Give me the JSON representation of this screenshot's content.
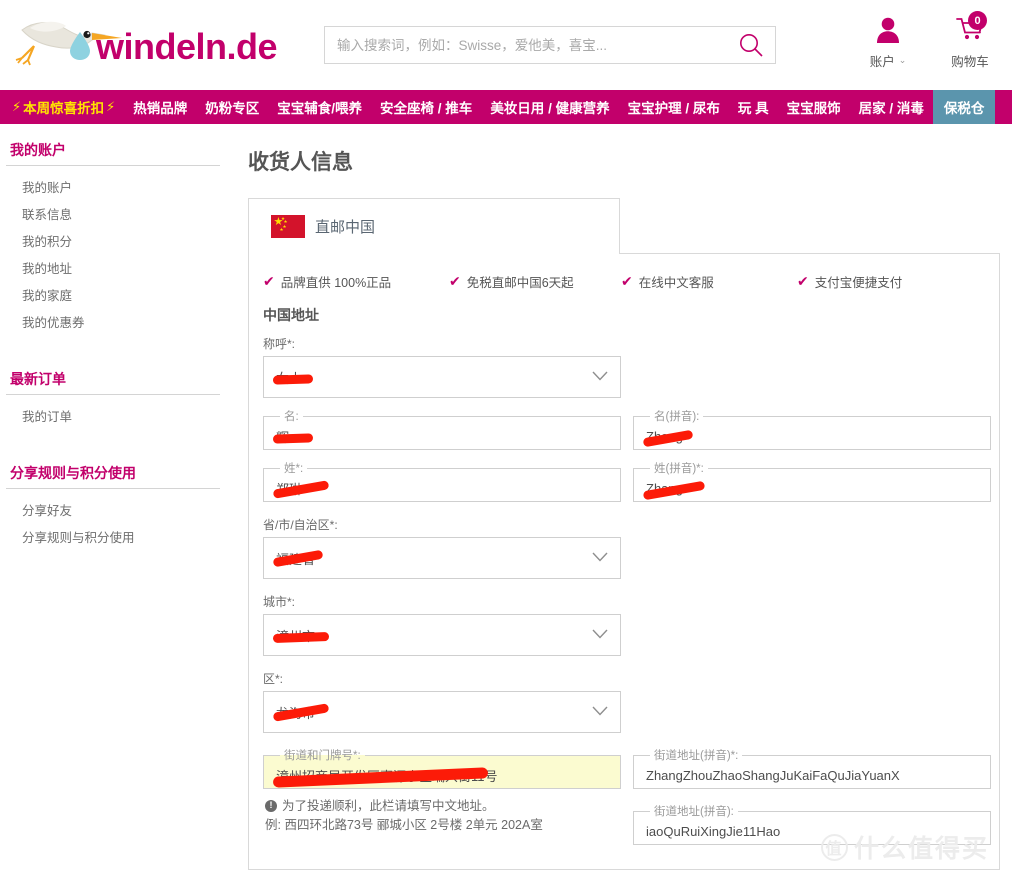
{
  "brand": {
    "name": "windeln.de",
    "logo_icon": "stork-logo",
    "accent": "#c2006b",
    "deal_color": "#ffe400",
    "bonded_tab_color": "#5b95ad"
  },
  "search": {
    "placeholder": "输入搜索词，例如：Swisse，爱他美，喜宝...",
    "value": "",
    "icon": "search-icon"
  },
  "header_actions": [
    {
      "label": "账户",
      "icon": "user-icon",
      "caret": "⌄",
      "badge": null
    },
    {
      "label": "购物车",
      "icon": "cart-icon",
      "caret": "",
      "badge": "0"
    }
  ],
  "nav": {
    "items": [
      {
        "label": "本周惊喜折扣",
        "style": "deal",
        "bolt": "⚡"
      },
      {
        "label": "热销品牌",
        "style": "normal"
      },
      {
        "label": "奶粉专区",
        "style": "normal"
      },
      {
        "label": "宝宝辅食/喂养",
        "style": "normal"
      },
      {
        "label": "安全座椅 / 推车",
        "style": "normal"
      },
      {
        "label": "美妆日用 / 健康营养",
        "style": "normal"
      },
      {
        "label": "宝宝护理 / 尿布",
        "style": "normal"
      },
      {
        "label": "玩 具",
        "style": "normal"
      },
      {
        "label": "宝宝服饰",
        "style": "normal"
      },
      {
        "label": "居家 / 消毒",
        "style": "normal"
      },
      {
        "label": "保税仓",
        "style": "bonded"
      }
    ]
  },
  "sidebar": {
    "groups": [
      {
        "title": "我的账户",
        "links": [
          "我的账户",
          "联系信息",
          "我的积分",
          "我的地址",
          "我的家庭",
          "我的优惠券"
        ]
      },
      {
        "title": "最新订单",
        "links": [
          "我的订单"
        ]
      },
      {
        "title": "分享规则与积分使用",
        "links": [
          "分享好友",
          "分享规则与积分使用"
        ]
      }
    ]
  },
  "main": {
    "page_title": "收货人信息",
    "tab": {
      "label": "直邮中国",
      "flag_icon": "china-flag-icon"
    },
    "benefits": [
      "品牌直供 100%正品",
      "免税直邮中国6天起",
      "在线中文客服",
      "支付宝便捷支付"
    ],
    "section_label": "中国地址",
    "fields": {
      "salutation": {
        "label": "称呼*:",
        "value": "女士",
        "type": "select",
        "redacted": true
      },
      "first_name": {
        "label": "名:",
        "value": "辉",
        "type": "text",
        "redacted": true
      },
      "first_name_pinyin": {
        "label": "名(拼音):",
        "value": "Zhong",
        "type": "text",
        "redacted": true
      },
      "last_name": {
        "label": "姓*:",
        "value": "郑琳",
        "type": "text",
        "redacted": true
      },
      "last_name_pinyin": {
        "label": "姓(拼音)*:",
        "value": "Zhang",
        "type": "text",
        "redacted": true
      },
      "province": {
        "label": "省/市/自治区*:",
        "value": "福建省",
        "type": "select",
        "redacted": true
      },
      "city": {
        "label": "城市*:",
        "value": "漳州市",
        "type": "select",
        "redacted": true
      },
      "district": {
        "label": "区*:",
        "value": "龙海市",
        "type": "select",
        "redacted": true
      },
      "street": {
        "label": "街道和门牌号*:",
        "value": "漳州招商局开发区嘉源小区瑞兴街11号",
        "type": "text",
        "redacted": true,
        "highlight": true
      },
      "street_pinyin_1": {
        "label": "街道地址(拼音)*:",
        "value": "ZhangZhouZhaoShangJuKaiFaQuJiaYuanX",
        "type": "text",
        "redacted": false
      },
      "street_pinyin_2": {
        "label": "街道地址(拼音):",
        "value": "iaoQuRuiXingJie11Hao",
        "type": "text",
        "redacted": false
      }
    },
    "hints": [
      {
        "icon": "info-icon",
        "text": "为了投递顺利，此栏请填写中文地址。"
      },
      {
        "icon": "",
        "text": "例: 西四环北路73号 郦城小区 2号楼 2单元 202A室"
      }
    ]
  },
  "watermark": {
    "mark": "值",
    "text": "什么值得买"
  }
}
